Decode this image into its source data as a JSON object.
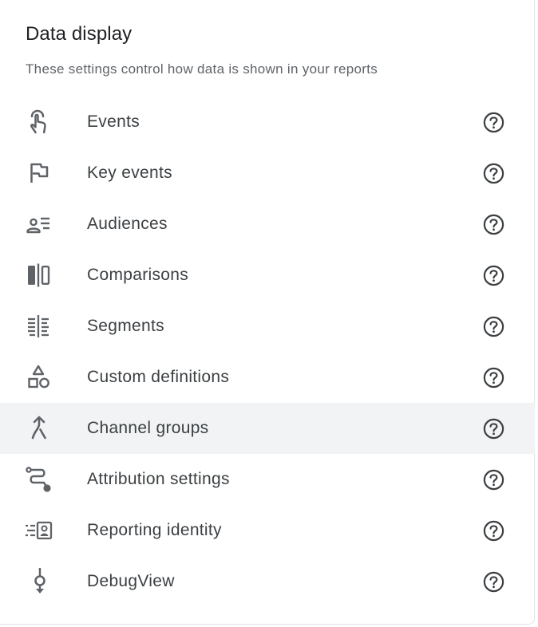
{
  "panel": {
    "title": "Data display",
    "subtitle": "These settings control how data is shown in your reports"
  },
  "colors": {
    "text": "#3c4043",
    "title": "#202124",
    "icon": "#5f6368",
    "hover_background": "#f1f3f4"
  },
  "items": [
    {
      "label": "Events",
      "icon": "touch-icon"
    },
    {
      "label": "Key events",
      "icon": "flag-icon"
    },
    {
      "label": "Audiences",
      "icon": "audience-list-icon"
    },
    {
      "label": "Comparisons",
      "icon": "compare-columns-icon"
    },
    {
      "label": "Segments",
      "icon": "segment-icon"
    },
    {
      "label": "Custom definitions",
      "icon": "shapes-icon"
    },
    {
      "label": "Channel groups",
      "icon": "merge-arrow-icon",
      "highlighted": true
    },
    {
      "label": "Attribution settings",
      "icon": "route-icon"
    },
    {
      "label": "Reporting identity",
      "icon": "id-card-icon"
    },
    {
      "label": "DebugView",
      "icon": "debug-commit-icon"
    }
  ],
  "help_icon": "help-circle-icon"
}
